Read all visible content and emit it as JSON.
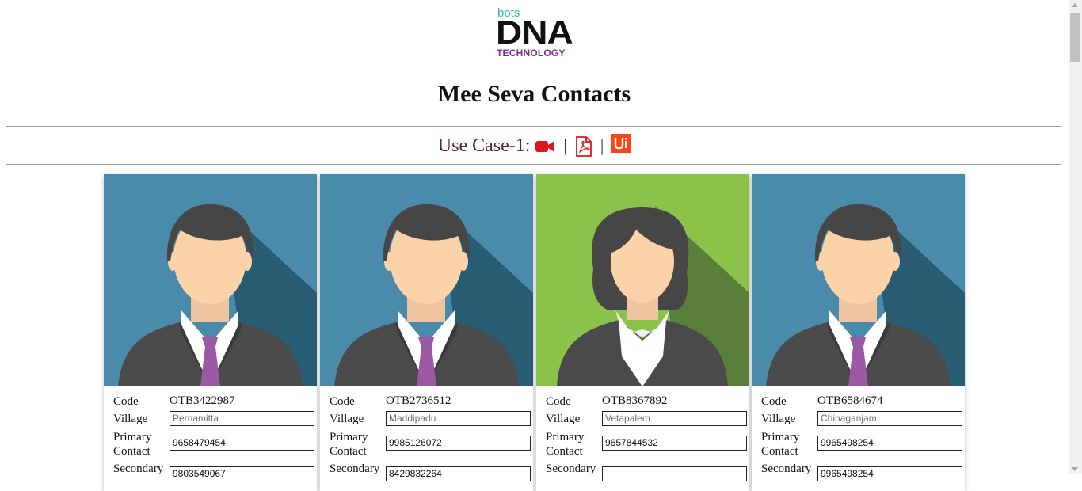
{
  "logo": {
    "top_text": "bots",
    "main_text": "DNA",
    "sub_text": "TECHNOLOGY"
  },
  "page_title": "Mee Seva Contacts",
  "use_case": {
    "label": "Use Case-1:",
    "separator": "|",
    "icons": [
      "video-camera-icon",
      "pdf-icon",
      "uipath-icon"
    ]
  },
  "labels": {
    "code": "Code",
    "village": "Village",
    "primary": "Primary",
    "primary2": "Contact",
    "secondary": "Secondary"
  },
  "colors": {
    "blue_bg": "#4a8aaa",
    "green_bg": "#8bc34a",
    "tie": "#9b59a4",
    "accent_red": "#e0141e",
    "uipath_orange": "#fa4616"
  },
  "contacts": [
    {
      "avatar": "male-avatar",
      "code": "OTB3422987",
      "village": "Pernamitta",
      "primary_contact": "9658479454",
      "secondary_contact": "9803549067"
    },
    {
      "avatar": "male-avatar",
      "code": "OTB2736512",
      "village": "Maddipadu",
      "primary_contact": "9985126072",
      "secondary_contact": "8429832264"
    },
    {
      "avatar": "female-avatar",
      "code": "OTB8367892",
      "village": "Vetapalem",
      "primary_contact": "9657844532",
      "secondary_contact": ""
    },
    {
      "avatar": "male-avatar",
      "code": "OTB6584674",
      "village": "Chinaganjam",
      "primary_contact": "9965498254",
      "secondary_contact": "9965498254"
    }
  ]
}
